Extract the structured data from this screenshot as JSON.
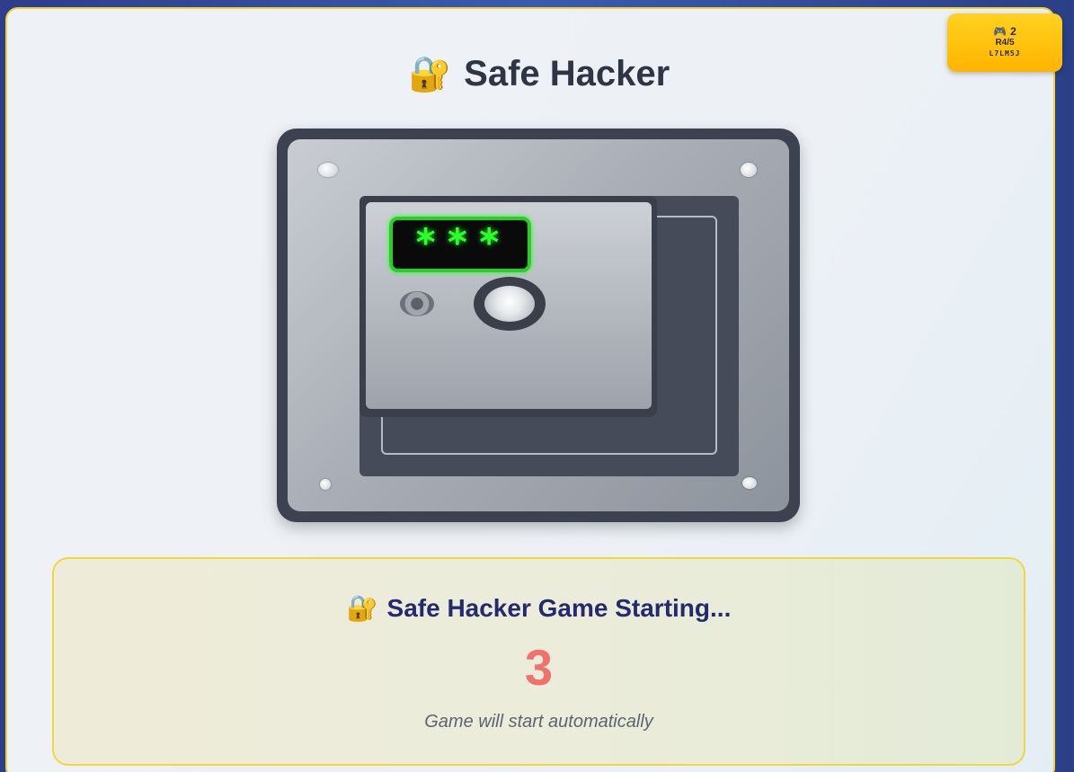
{
  "header": {
    "lock_icon": "lock-with-key-icon",
    "title": "Safe Hacker"
  },
  "badge": {
    "controller_icon": "game-controller-icon",
    "players": "2",
    "round": "R4/5",
    "code": "L7LM5J"
  },
  "safe": {
    "display_text": "***",
    "display_color": "#2dff2d"
  },
  "status_panel": {
    "icon": "lock-with-key-icon",
    "title": "Safe Hacker Game Starting...",
    "countdown": "3",
    "subtitle": "Game will start automatically",
    "countdown_color": "#f2716d"
  }
}
